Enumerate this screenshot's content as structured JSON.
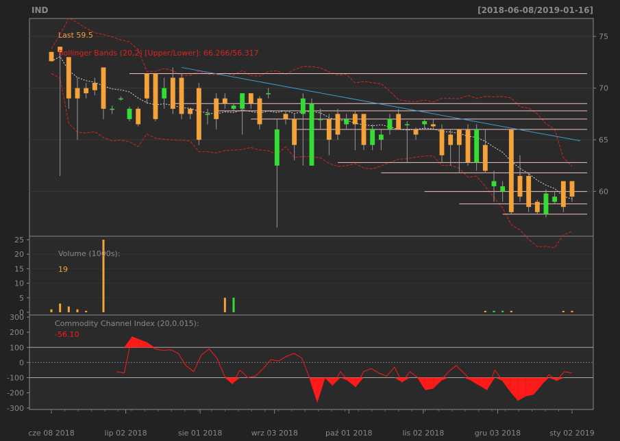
{
  "chart_data": [
    {
      "type": "candlestick",
      "symbol": "IND",
      "date_range": "[2018-06-08/2019-01-16]",
      "last_label": "Last 59.5",
      "bb_label": "Bollinger Bands (20,2) [Upper/Lower]: 66.266/56.317",
      "y_ticks": [
        60,
        65,
        70,
        75
      ],
      "ylim": [
        55.8,
        76.6
      ],
      "trendline": {
        "from": 72.0,
        "to": 64.9
      },
      "levels": [
        71.4,
        68.5,
        67.8,
        67.0,
        66.0,
        62.8,
        61.8,
        60.0,
        58.8,
        57.8
      ],
      "candles": [
        {
          "o": 73.5,
          "c": 72.6,
          "h": 73.5,
          "l": 72.6
        },
        {
          "o": 74.0,
          "c": 73.5,
          "h": 74.0,
          "l": 61.5
        },
        {
          "o": 73.0,
          "c": 69.0,
          "h": 73.0,
          "l": 68.0
        },
        {
          "o": 70.0,
          "c": 69.0,
          "h": 71.0,
          "l": 65.0
        },
        {
          "o": 70.0,
          "c": 69.5,
          "h": 70.5,
          "l": 69.0
        },
        {
          "o": 70.5,
          "c": 69.8,
          "h": 71.0,
          "l": 69.3
        },
        {
          "o": 72.0,
          "c": 68.0,
          "h": 72.0,
          "l": 67.0
        },
        {
          "o": 68.0,
          "c": 68.0,
          "h": 68.3,
          "l": 67.5
        },
        {
          "o": 69.0,
          "c": 69.0,
          "h": 69.2,
          "l": 68.8
        },
        {
          "o": 67.0,
          "c": 68.0,
          "h": 68.2,
          "l": 66.8
        },
        {
          "o": 68.0,
          "c": 66.5,
          "h": 68.2,
          "l": 66.3
        },
        {
          "o": 71.4,
          "c": 69.0,
          "h": 71.4,
          "l": 68.5
        },
        {
          "o": 71.4,
          "c": 67.0,
          "h": 71.4,
          "l": 66.8
        },
        {
          "o": 69.0,
          "c": 70.0,
          "h": 71.0,
          "l": 68.0
        },
        {
          "o": 71.0,
          "c": 68.0,
          "h": 72.0,
          "l": 67.5
        },
        {
          "o": 71.0,
          "c": 67.5,
          "h": 71.4,
          "l": 67.0
        },
        {
          "o": 68.0,
          "c": 67.5,
          "h": 68.0,
          "l": 67.0
        },
        {
          "o": 70.0,
          "c": 65.0,
          "h": 70.5,
          "l": 64.5
        },
        {
          "o": 67.5,
          "c": 67.5,
          "h": 68.0,
          "l": 66.5
        },
        {
          "o": 69.0,
          "c": 67.0,
          "h": 69.5,
          "l": 66.0
        },
        {
          "o": 69.0,
          "c": 68.5,
          "h": 69.5,
          "l": 68.0
        },
        {
          "o": 68.0,
          "c": 68.3,
          "h": 68.5,
          "l": 67.8
        },
        {
          "o": 68.0,
          "c": 69.5,
          "h": 69.5,
          "l": 65.5
        },
        {
          "o": 69.5,
          "c": 68.5,
          "h": 69.5,
          "l": 68.0
        },
        {
          "o": 69.0,
          "c": 66.5,
          "h": 69.2,
          "l": 66.0
        },
        {
          "o": 69.5,
          "c": 69.5,
          "h": 70.0,
          "l": 69.0
        },
        {
          "o": 62.5,
          "c": 66.0,
          "h": 67.0,
          "l": 56.5
        },
        {
          "o": 67.5,
          "c": 67.0,
          "h": 67.8,
          "l": 66.5
        },
        {
          "o": 67.0,
          "c": 64.5,
          "h": 67.5,
          "l": 63.0
        },
        {
          "o": 67.5,
          "c": 69.0,
          "h": 69.5,
          "l": 62.5
        },
        {
          "o": 62.5,
          "c": 68.5,
          "h": 69.0,
          "l": 62.5
        },
        {
          "o": 67.0,
          "c": 67.0,
          "h": 68.0,
          "l": 66.0
        },
        {
          "o": 67.0,
          "c": 65.0,
          "h": 67.5,
          "l": 63.5
        },
        {
          "o": 67.5,
          "c": 65.5,
          "h": 68.0,
          "l": 65.0
        },
        {
          "o": 66.5,
          "c": 67.0,
          "h": 67.5,
          "l": 66.0
        },
        {
          "o": 67.5,
          "c": 66.5,
          "h": 67.8,
          "l": 64.0
        },
        {
          "o": 67.5,
          "c": 64.5,
          "h": 67.5,
          "l": 64.0
        },
        {
          "o": 64.5,
          "c": 66.0,
          "h": 66.5,
          "l": 64.0
        },
        {
          "o": 65.0,
          "c": 65.5,
          "h": 66.0,
          "l": 64.0
        },
        {
          "o": 66.0,
          "c": 67.0,
          "h": 67.5,
          "l": 65.5
        },
        {
          "o": 67.5,
          "c": 66.0,
          "h": 68.0,
          "l": 66.0
        },
        {
          "o": 66.5,
          "c": 66.5,
          "h": 66.8,
          "l": 62.8
        },
        {
          "o": 66.0,
          "c": 65.5,
          "h": 66.2,
          "l": 65.0
        },
        {
          "o": 66.5,
          "c": 66.8,
          "h": 67.0,
          "l": 66.0
        },
        {
          "o": 66.5,
          "c": 66.3,
          "h": 67.0,
          "l": 66.0
        },
        {
          "o": 66.0,
          "c": 63.5,
          "h": 66.5,
          "l": 62.8
        },
        {
          "o": 65.5,
          "c": 64.5,
          "h": 66.0,
          "l": 62.5
        },
        {
          "o": 66.0,
          "c": 64.5,
          "h": 66.0,
          "l": 61.8
        },
        {
          "o": 66.0,
          "c": 62.8,
          "h": 66.5,
          "l": 62.5
        },
        {
          "o": 62.8,
          "c": 66.0,
          "h": 66.5,
          "l": 62.0
        },
        {
          "o": 64.5,
          "c": 62.0,
          "h": 66.0,
          "l": 61.8
        },
        {
          "o": 60.5,
          "c": 61.0,
          "h": 62.0,
          "l": 59.0
        },
        {
          "o": 60.0,
          "c": 60.5,
          "h": 61.0,
          "l": 59.0
        },
        {
          "o": 66.0,
          "c": 58.0,
          "h": 66.0,
          "l": 57.8
        },
        {
          "o": 61.5,
          "c": 59.5,
          "h": 63.5,
          "l": 59.0
        },
        {
          "o": 61.5,
          "c": 58.5,
          "h": 61.8,
          "l": 58.0
        },
        {
          "o": 59.0,
          "c": 58.0,
          "h": 59.2,
          "l": 57.8
        },
        {
          "o": 57.8,
          "c": 59.8,
          "h": 60.2,
          "l": 57.5
        },
        {
          "o": 59.0,
          "c": 59.5,
          "h": 60.0,
          "l": 58.8
        },
        {
          "o": 61.0,
          "c": 58.5,
          "h": 61.0,
          "l": 58.0
        },
        {
          "o": 61.0,
          "c": 59.5,
          "h": 61.0,
          "l": 59.0
        }
      ]
    },
    {
      "type": "bar",
      "title": "Volume (1000s):",
      "last_value": "19",
      "y_ticks": [
        0,
        5,
        10,
        15,
        20,
        25
      ],
      "ylim": [
        0,
        25
      ],
      "values": [
        1,
        3,
        2,
        1,
        0.5,
        0,
        25,
        0,
        0,
        0,
        0,
        0,
        0,
        0,
        0,
        0,
        0,
        0,
        0,
        0,
        5,
        5,
        0,
        0,
        0,
        0,
        0,
        0,
        0,
        0,
        0,
        0,
        0,
        0,
        0,
        0,
        0,
        0,
        0,
        0,
        0,
        0,
        0,
        0,
        0,
        0,
        0,
        0,
        0,
        0,
        0.5,
        0.5,
        0.5,
        0.5,
        0,
        0,
        0,
        0,
        0,
        0.5,
        0.5
      ]
    },
    {
      "type": "line",
      "title": "Commodity Channel Index (20,0.015):",
      "last_value": "-56.10",
      "y_ticks": [
        -300,
        -200,
        -100,
        0,
        100,
        200,
        300
      ],
      "ylim": [
        -310,
        300
      ],
      "hlines": [
        100,
        0,
        -100
      ],
      "values": [
        -60,
        -70,
        170,
        150,
        130,
        90,
        80,
        85,
        60,
        -20,
        -60,
        50,
        90,
        30,
        -90,
        -140,
        -50,
        -100,
        -90,
        -40,
        20,
        10,
        40,
        60,
        30,
        -100,
        -260,
        -100,
        -150,
        -60,
        -120,
        -160,
        -60,
        -40,
        -70,
        -90,
        -30,
        -130,
        -60,
        -100,
        -180,
        -170,
        -120,
        -60,
        -20,
        -70,
        -120,
        -150,
        -180,
        -50,
        -120,
        -190,
        -250,
        -220,
        -210,
        -150,
        -80,
        -120,
        -60,
        -70
      ]
    }
  ],
  "x_labels": [
    "cze 08 2018",
    "lip 02 2018",
    "sie 01 2018",
    "wrz 03 2018",
    "paź 01 2018",
    "lis 02 2018",
    "gru 03 2018",
    "sty 02 2019"
  ],
  "colors": {
    "up": "#33dd33",
    "down": "#f5a23a",
    "bb": "#dd2222",
    "trend": "#3a9fd8",
    "level": "#f4c3c3",
    "cci": "#ff1a1a"
  }
}
